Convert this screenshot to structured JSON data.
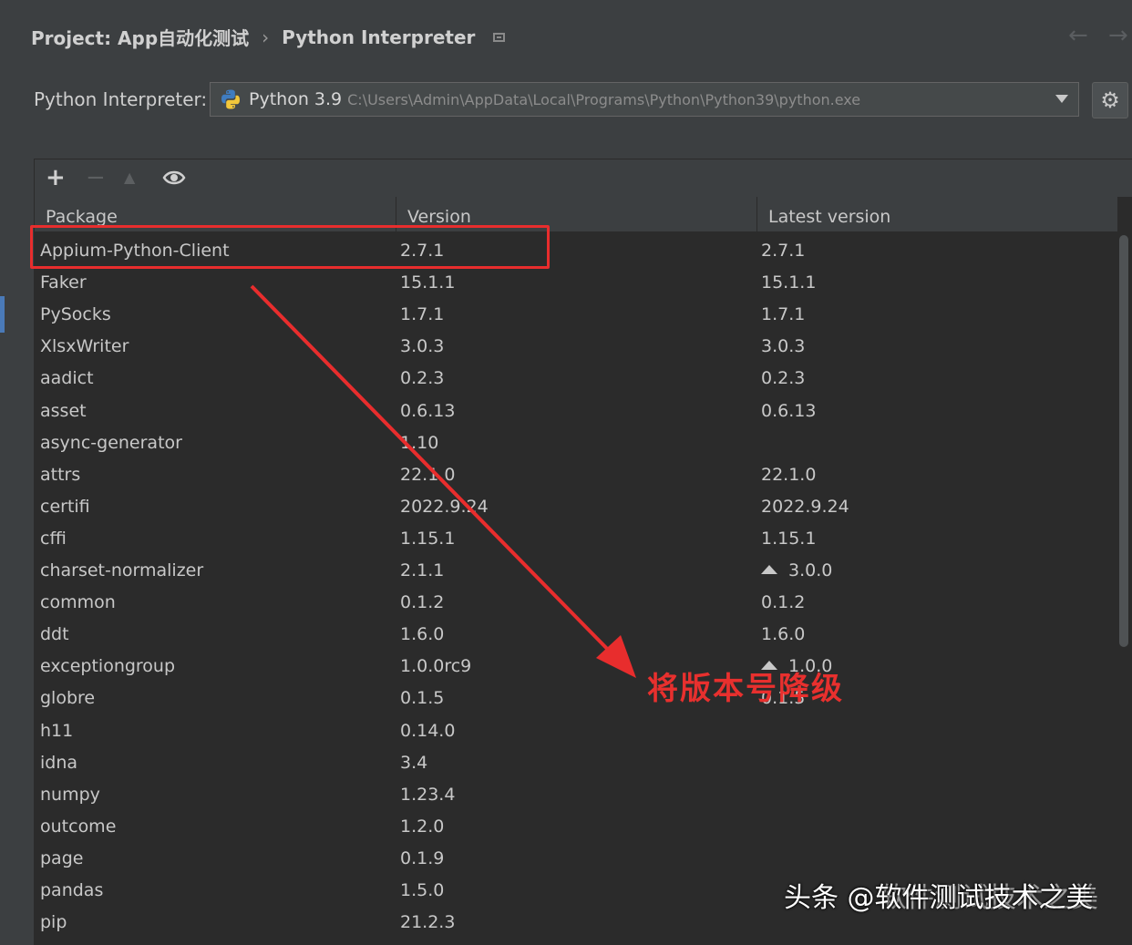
{
  "breadcrumb": {
    "project": "Project: App自动化测试",
    "separator": "›",
    "page": "Python Interpreter"
  },
  "nav": {
    "back": "←",
    "forward": "→"
  },
  "interpreter": {
    "label": "Python Interpreter:",
    "name": "Python 3.9",
    "path": "C:\\Users\\Admin\\AppData\\Local\\Programs\\Python\\Python39\\python.exe"
  },
  "toolbar": {
    "add": "+",
    "remove": "−",
    "upgrade": "▲",
    "show": "👁"
  },
  "table": {
    "headers": [
      "Package",
      "Version",
      "Latest version"
    ],
    "rows": [
      {
        "name": "Appium-Python-Client",
        "version": "2.7.1",
        "latest": "2.7.1",
        "upgrade": false
      },
      {
        "name": "Faker",
        "version": "15.1.1",
        "latest": "15.1.1",
        "upgrade": false
      },
      {
        "name": "PySocks",
        "version": "1.7.1",
        "latest": "1.7.1",
        "upgrade": false
      },
      {
        "name": "XlsxWriter",
        "version": "3.0.3",
        "latest": "3.0.3",
        "upgrade": false
      },
      {
        "name": "aadict",
        "version": "0.2.3",
        "latest": "0.2.3",
        "upgrade": false
      },
      {
        "name": "asset",
        "version": "0.6.13",
        "latest": "0.6.13",
        "upgrade": false
      },
      {
        "name": "async-generator",
        "version": "1.10",
        "latest": "",
        "upgrade": false
      },
      {
        "name": "attrs",
        "version": "22.1.0",
        "latest": "22.1.0",
        "upgrade": false
      },
      {
        "name": "certifi",
        "version": "2022.9.24",
        "latest": "2022.9.24",
        "upgrade": false
      },
      {
        "name": "cffi",
        "version": "1.15.1",
        "latest": "1.15.1",
        "upgrade": false
      },
      {
        "name": "charset-normalizer",
        "version": "2.1.1",
        "latest": "3.0.0",
        "upgrade": true
      },
      {
        "name": "common",
        "version": "0.1.2",
        "latest": "0.1.2",
        "upgrade": false
      },
      {
        "name": "ddt",
        "version": "1.6.0",
        "latest": "1.6.0",
        "upgrade": false
      },
      {
        "name": "exceptiongroup",
        "version": "1.0.0rc9",
        "latest": "1.0.0",
        "upgrade": true
      },
      {
        "name": "globre",
        "version": "0.1.5",
        "latest": "0.1.5",
        "upgrade": false
      },
      {
        "name": "h11",
        "version": "0.14.0",
        "latest": "",
        "upgrade": false
      },
      {
        "name": "idna",
        "version": "3.4",
        "latest": "",
        "upgrade": false
      },
      {
        "name": "numpy",
        "version": "1.23.4",
        "latest": "",
        "upgrade": false
      },
      {
        "name": "outcome",
        "version": "1.2.0",
        "latest": "",
        "upgrade": false
      },
      {
        "name": "page",
        "version": "0.1.9",
        "latest": "",
        "upgrade": false
      },
      {
        "name": "pandas",
        "version": "1.5.0",
        "latest": "",
        "upgrade": false
      },
      {
        "name": "pip",
        "version": "21.2.3",
        "latest": "",
        "upgrade": false
      }
    ]
  },
  "annotation": {
    "text": "将版本号降级",
    "color": "#e8302e"
  },
  "watermark": {
    "text": "头条 @软件测试技术之美",
    "ghost": "软件测试技术之美"
  }
}
